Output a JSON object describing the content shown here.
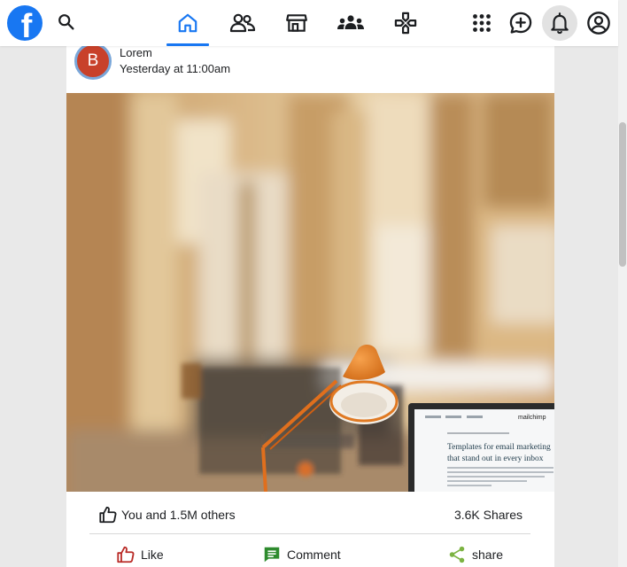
{
  "colors": {
    "brand": "#1877f2",
    "like_icon": "#b92b27",
    "comment_icon": "#2e8b2e",
    "share_icon": "#7cb342"
  },
  "topbar": {
    "logo_glyph": "f",
    "search_icon": "search-icon",
    "tabs": [
      {
        "icon": "home-icon",
        "active": true
      },
      {
        "icon": "friends-icon",
        "active": false
      },
      {
        "icon": "marketplace-icon",
        "active": false
      },
      {
        "icon": "groups-icon",
        "active": false
      },
      {
        "icon": "gaming-icon",
        "active": false
      }
    ],
    "right_icons": [
      "grid-menu-icon",
      "messenger-icon",
      "bell-icon",
      "account-icon"
    ]
  },
  "post": {
    "avatar_initial": "B",
    "author": "Lorem",
    "time": "Yesterday at 11:00am",
    "image": {
      "laptop_brand": "mailchimp",
      "laptop_headline_1": "Templates for email marketing",
      "laptop_headline_2": "that stand out in every inbox"
    },
    "likes_text": "You and 1.5M others",
    "shares_text": "3.6K Shares",
    "actions": {
      "like": "Like",
      "comment": "Comment",
      "share": "share"
    }
  }
}
